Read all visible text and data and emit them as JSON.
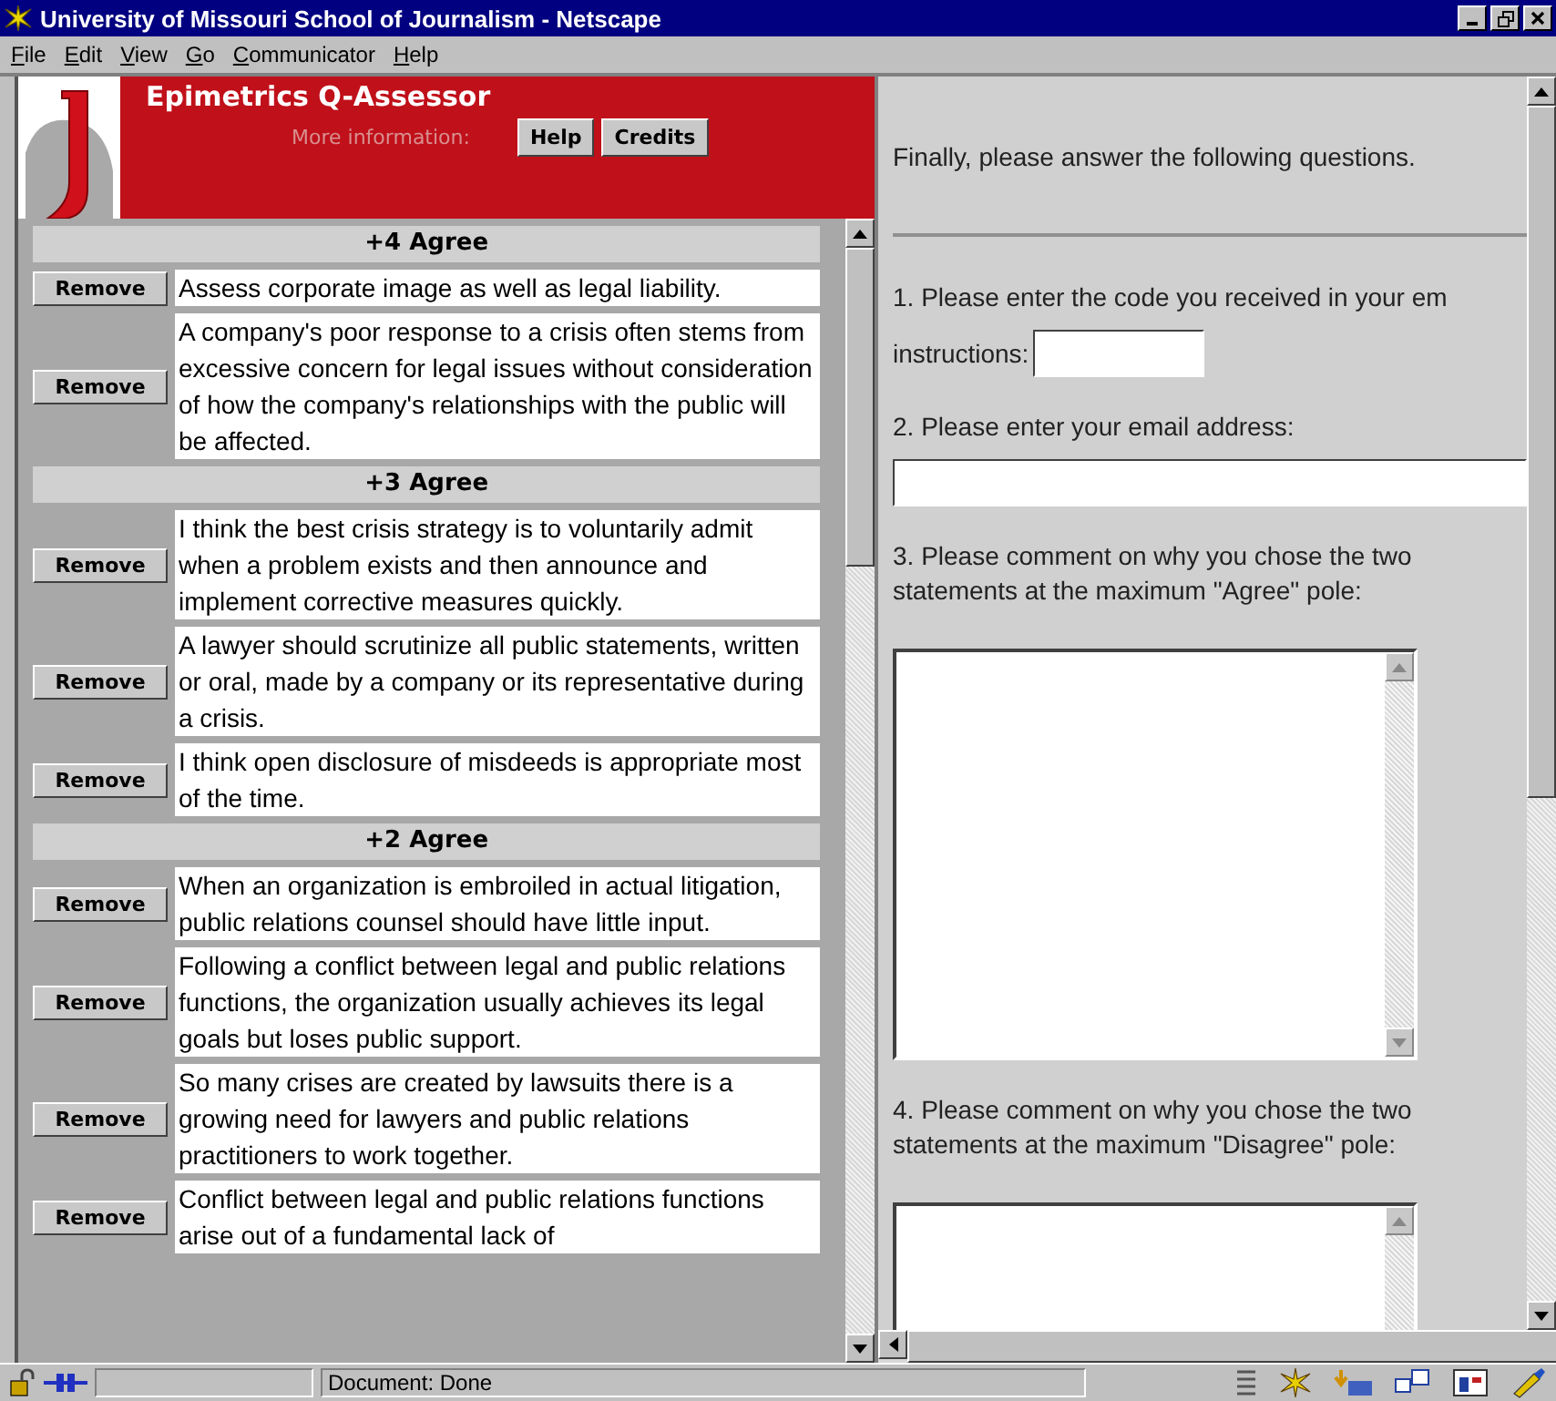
{
  "window": {
    "title": "University of Missouri School of Journalism - Netscape"
  },
  "menu": [
    "File",
    "Edit",
    "View",
    "Go",
    "Communicator",
    "Help"
  ],
  "header": {
    "title": "Epimetrics Q-Assessor",
    "info_label": "More information:",
    "buttons": [
      "Help",
      "Credits"
    ]
  },
  "groups": [
    {
      "heading": "+4 Agree",
      "statements": [
        {
          "button": "Remove",
          "text": "Assess corporate image as well as legal liability."
        },
        {
          "button": "Remove",
          "text": "A company's poor response to a crisis often stems from excessive concern for legal issues without consideration of how the company's relationships with the public will be affected."
        }
      ]
    },
    {
      "heading": "+3 Agree",
      "statements": [
        {
          "button": "Remove",
          "text": "I think the best crisis strategy is to voluntarily admit when a problem exists and then announce and implement corrective measures quickly."
        },
        {
          "button": "Remove",
          "text": "A lawyer should scrutinize all public statements, written or oral, made by a company or its representative during a crisis."
        },
        {
          "button": "Remove",
          "text": "I think open disclosure of misdeeds is appropriate most of the time."
        }
      ]
    },
    {
      "heading": "+2 Agree",
      "statements": [
        {
          "button": "Remove",
          "text": "When an organization is embroiled in actual litigation, public relations counsel should have little input."
        },
        {
          "button": "Remove",
          "text": "Following a conflict between legal and public relations functions, the organization usually achieves its legal goals but loses public support."
        },
        {
          "button": "Remove",
          "text": "So many crises are created by lawsuits there is a growing need for lawyers and public relations practitioners to work together."
        },
        {
          "button": "Remove",
          "text": "Conflict between legal and public relations functions arise out of a fundamental lack of"
        }
      ]
    }
  ],
  "form": {
    "intro": "Finally, please answer the following questions.",
    "questions": [
      {
        "kind": "short",
        "text": "1. Please enter the code you received in your em",
        "label": "instructions:"
      },
      {
        "kind": "line",
        "text": "2. Please enter your email address:"
      },
      {
        "kind": "area",
        "text": "3. Please comment on why you chose the two statements at the maximum \"Agree\" pole:"
      },
      {
        "kind": "area",
        "text": "4. Please comment on why you chose the two statements at the maximum \"Disagree\" pole:"
      }
    ]
  },
  "status_bar": {
    "text": "Document: Done"
  }
}
